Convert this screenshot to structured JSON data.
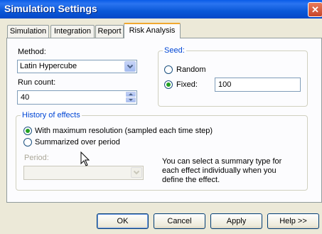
{
  "window": {
    "title": "Simulation Settings",
    "close_glyph": "✕"
  },
  "tabs": [
    {
      "label": "Simulation"
    },
    {
      "label": "Integration"
    },
    {
      "label": "Report"
    },
    {
      "label": "Risk Analysis",
      "active": true
    }
  ],
  "method": {
    "label": "Method:",
    "value": "Latin Hypercube"
  },
  "run_count": {
    "label": "Run count:",
    "value": "40"
  },
  "seed": {
    "legend": "Seed:",
    "random_label": "Random",
    "fixed_label": "Fixed:",
    "fixed_value": "100",
    "selected": "fixed"
  },
  "history": {
    "legend": "History of effects",
    "option_max": "With maximum resolution (sampled each time step)",
    "option_summary": "Summarized over period",
    "selected": "max",
    "period_label": "Period:",
    "period_value": "",
    "info_text_1": "You can select a summary type for",
    "info_text_2": "each effect individually when you",
    "info_text_3": "define the effect."
  },
  "buttons": {
    "ok": "OK",
    "cancel": "Cancel",
    "apply": "Apply",
    "help": "Help >>"
  },
  "colors": {
    "accent_blue": "#0046d5",
    "titlebar": "#0a5ce8",
    "radio_dot": "#21a121"
  }
}
